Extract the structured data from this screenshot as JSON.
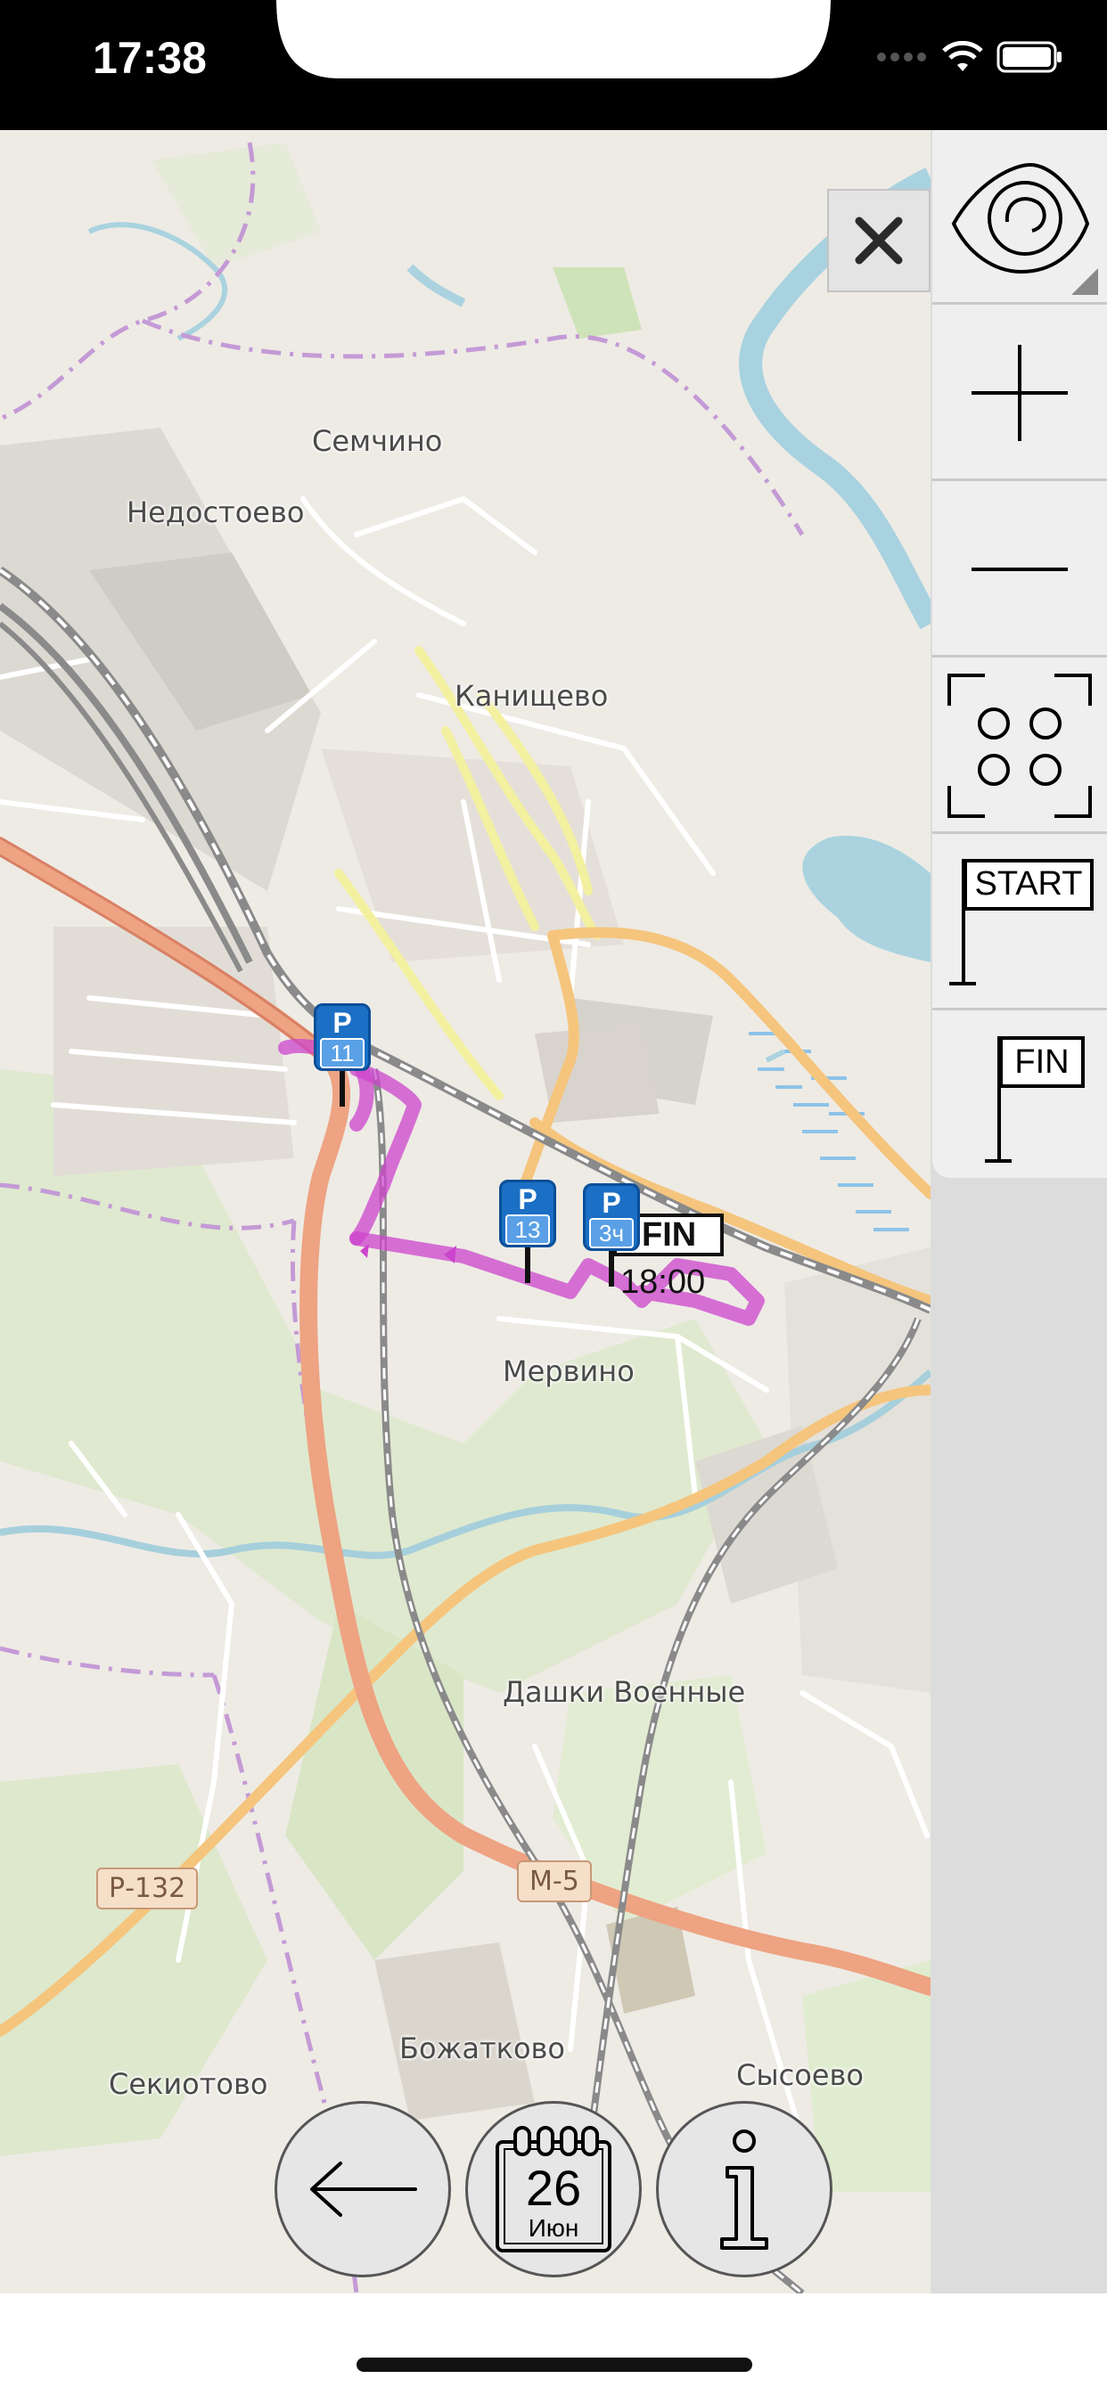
{
  "status_bar": {
    "time": "17:38",
    "icons": [
      "signal-dots-icon",
      "wifi-icon",
      "battery-icon"
    ]
  },
  "map": {
    "places": [
      {
        "name": "Семчино"
      },
      {
        "name": "Недостоево"
      },
      {
        "name": "Канищево"
      },
      {
        "name": "Мервино"
      },
      {
        "name": "Дашки Военные"
      },
      {
        "name": "Божатково"
      },
      {
        "name": "Секиотово"
      },
      {
        "name": "Сысоево"
      }
    ],
    "road_shields": [
      "Р-132",
      "М-5"
    ],
    "parking_markers": [
      {
        "letter": "P",
        "value": "11"
      },
      {
        "letter": "P",
        "value": "13"
      },
      {
        "letter": "P",
        "value": "3ч"
      }
    ],
    "fin_flag": {
      "label": "FIN",
      "time": "18:00"
    },
    "route_color": "#cc44cc"
  },
  "controls": {
    "close_icon": "close-icon",
    "tools": [
      {
        "name": "visibility-eye-icon"
      },
      {
        "name": "zoom-in-icon"
      },
      {
        "name": "zoom-out-icon"
      },
      {
        "name": "fit-view-icon"
      },
      {
        "name": "start-flag-button",
        "label": "START"
      },
      {
        "name": "finish-flag-button",
        "label": "FIN"
      }
    ]
  },
  "bottom_buttons": {
    "back_icon": "back-arrow-icon",
    "calendar": {
      "day": "26",
      "month": "Июн"
    },
    "info_icon": "info-icon"
  }
}
